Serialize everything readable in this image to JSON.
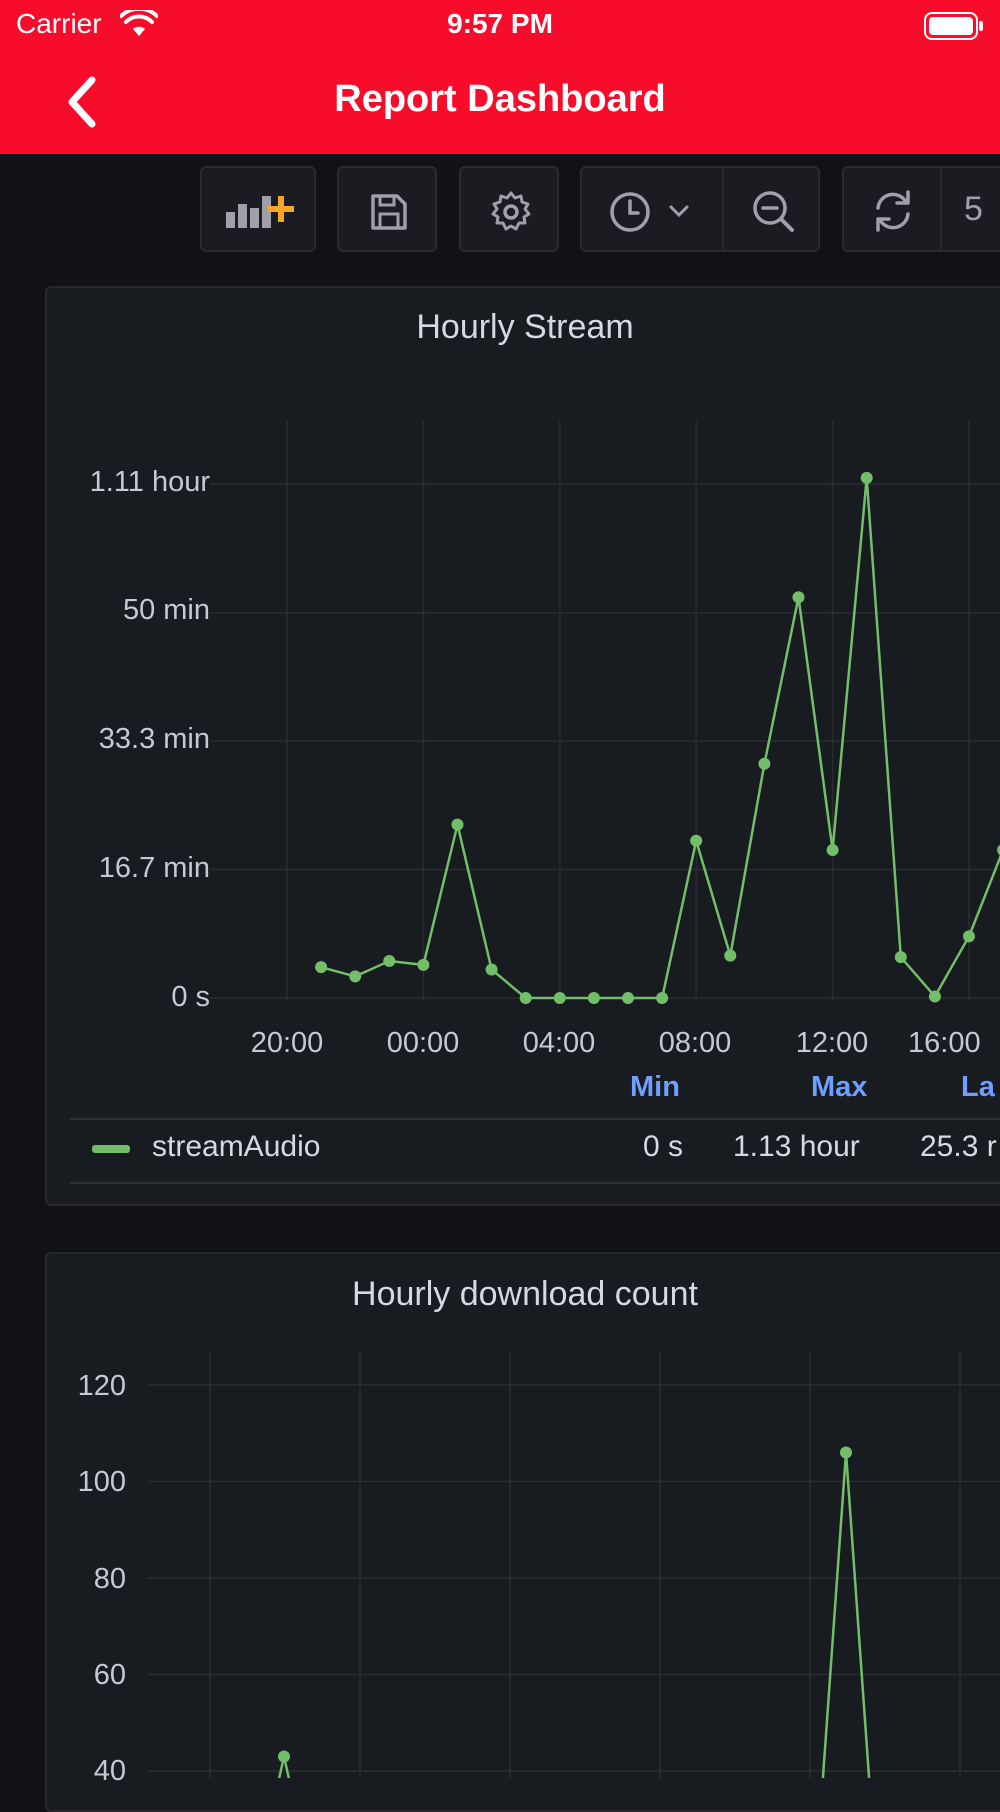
{
  "status_bar": {
    "carrier": "Carrier",
    "time": "9:57 PM"
  },
  "nav": {
    "title": "Report Dashboard"
  },
  "toolbar": {
    "refresh_interval_label": "5"
  },
  "panel1": {
    "title": "Hourly Stream",
    "legend": {
      "headers": [
        "Min",
        "Max",
        "La"
      ],
      "series_name": "streamAudio",
      "values": [
        "0 s",
        "1.13 hour",
        "25.3 r"
      ]
    },
    "series_color": "#73bf69",
    "chart_data": {
      "type": "line",
      "y_tick_labels": [
        "1.11 hour",
        "50 min",
        "33.3 min",
        "16.7 min",
        "0 s"
      ],
      "x_tick_labels": [
        "20:00",
        "00:00",
        "04:00",
        "08:00",
        "12:00",
        "16:00"
      ],
      "ylim_minutes": [
        0,
        66.7
      ],
      "series": [
        {
          "name": "streamAudio",
          "x_hours": [
            21,
            22,
            23,
            24,
            25,
            26,
            27,
            28,
            29,
            30,
            31,
            32,
            33,
            34,
            35,
            36,
            37,
            38,
            39,
            40,
            41
          ],
          "y_minutes": [
            4,
            2.8,
            4.8,
            4.3,
            22.5,
            3.7,
            0,
            0,
            0,
            0,
            0,
            20.4,
            5.5,
            30.4,
            52,
            19.2,
            67.5,
            5.3,
            0.2,
            8,
            19.2
          ]
        }
      ]
    }
  },
  "panel2": {
    "title": "Hourly download count",
    "series_color": "#73bf69",
    "chart_data": {
      "type": "line",
      "y_tick_labels": [
        "120",
        "100",
        "80",
        "60",
        "40"
      ],
      "series": [
        {
          "name": "",
          "x_index": [
            0,
            1,
            2,
            3,
            4,
            5
          ],
          "y": [
            30,
            43,
            30,
            30,
            106,
            30
          ]
        }
      ]
    }
  }
}
